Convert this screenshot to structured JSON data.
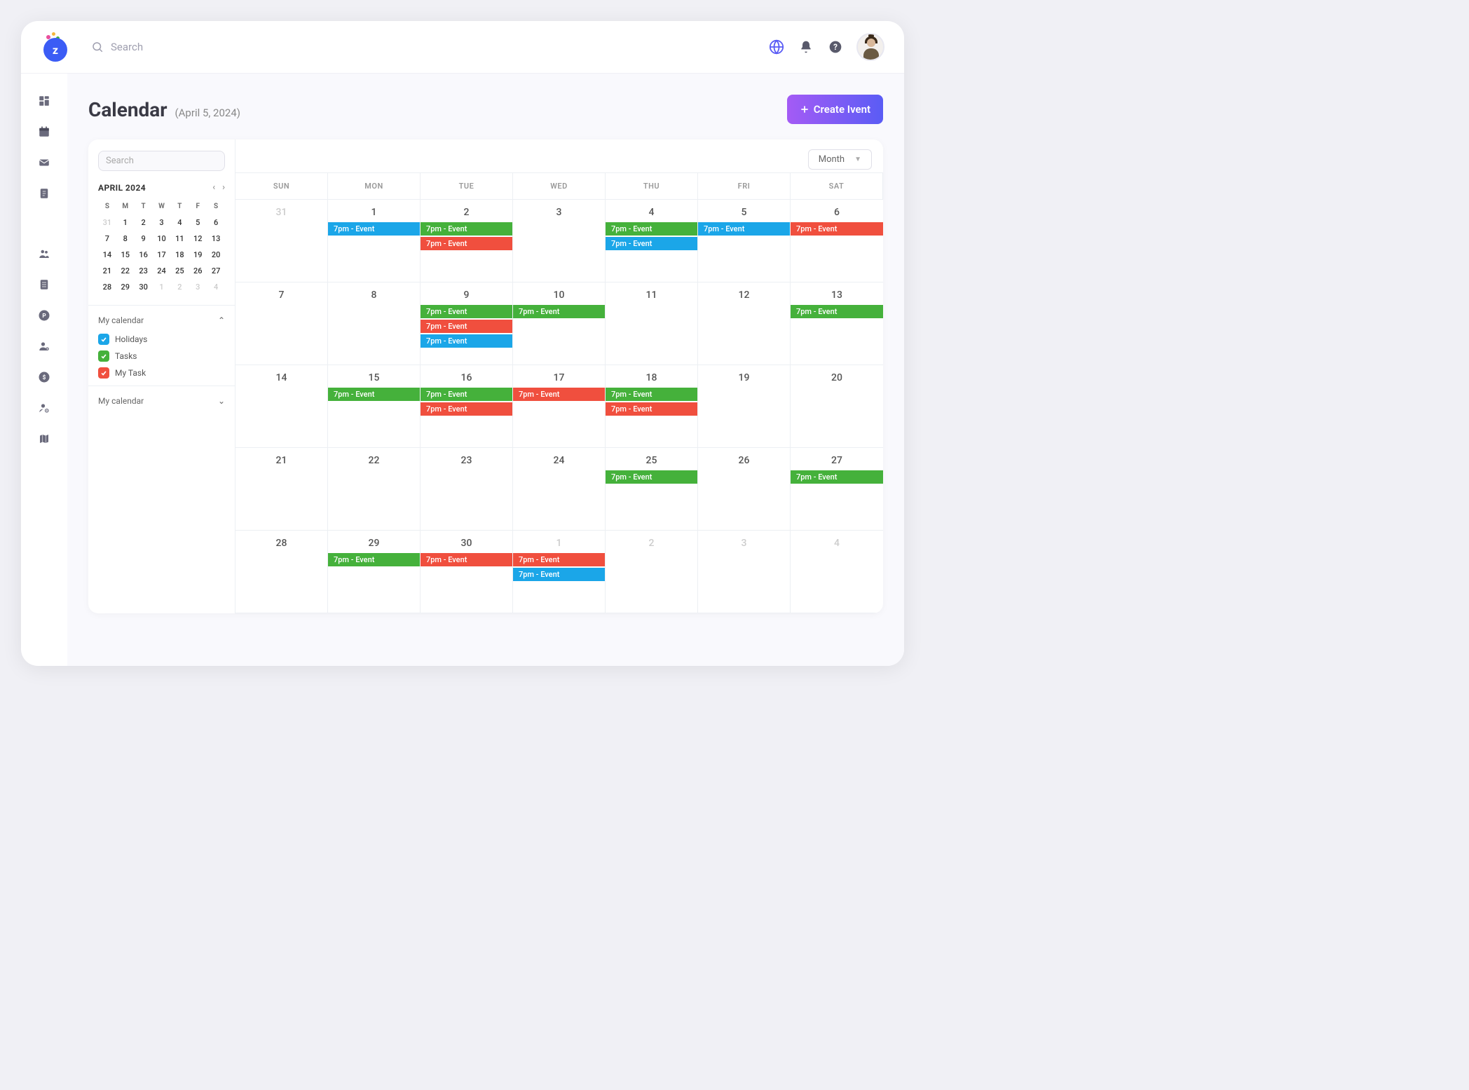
{
  "topbar": {
    "search_placeholder": "Search"
  },
  "page": {
    "title": "Calendar",
    "date_suffix": "(April 5, 2024)",
    "create_btn": "Create Ivent"
  },
  "panel": {
    "search_placeholder": "Search",
    "view_selected": "Month"
  },
  "mini_cal": {
    "month_label": "APRIL 2024",
    "dows": [
      "S",
      "M",
      "T",
      "W",
      "T",
      "F",
      "S"
    ],
    "days": [
      {
        "n": "31",
        "dim": true
      },
      {
        "n": "1"
      },
      {
        "n": "2"
      },
      {
        "n": "3"
      },
      {
        "n": "4"
      },
      {
        "n": "5"
      },
      {
        "n": "6"
      },
      {
        "n": "7"
      },
      {
        "n": "8"
      },
      {
        "n": "9"
      },
      {
        "n": "10"
      },
      {
        "n": "11"
      },
      {
        "n": "12"
      },
      {
        "n": "13"
      },
      {
        "n": "14"
      },
      {
        "n": "15"
      },
      {
        "n": "16"
      },
      {
        "n": "17"
      },
      {
        "n": "18"
      },
      {
        "n": "19"
      },
      {
        "n": "20"
      },
      {
        "n": "21"
      },
      {
        "n": "22"
      },
      {
        "n": "23"
      },
      {
        "n": "24"
      },
      {
        "n": "25"
      },
      {
        "n": "26"
      },
      {
        "n": "27"
      },
      {
        "n": "28"
      },
      {
        "n": "29"
      },
      {
        "n": "30"
      },
      {
        "n": "1",
        "dim": true
      },
      {
        "n": "2",
        "dim": true
      },
      {
        "n": "3",
        "dim": true
      },
      {
        "n": "4",
        "dim": true
      }
    ]
  },
  "cal_list": {
    "section1": "My calendar",
    "items": [
      {
        "label": "Holidays",
        "color": "blue"
      },
      {
        "label": "Tasks",
        "color": "green"
      },
      {
        "label": "My Task",
        "color": "red"
      }
    ],
    "section2": "My calendar"
  },
  "big_cal": {
    "dows": [
      "SUN",
      "MON",
      "TUE",
      "WED",
      "THU",
      "FRI",
      "SAT"
    ],
    "event_label": "7pm - Event",
    "weeks": [
      [
        {
          "n": "31",
          "dim": true,
          "events": []
        },
        {
          "n": "1",
          "events": [
            "blue"
          ]
        },
        {
          "n": "2",
          "events": [
            "green",
            "red"
          ]
        },
        {
          "n": "3",
          "events": []
        },
        {
          "n": "4",
          "events": [
            "green",
            "blue"
          ]
        },
        {
          "n": "5",
          "events": [
            "blue"
          ]
        },
        {
          "n": "6",
          "events": [
            "red"
          ]
        }
      ],
      [
        {
          "n": "7",
          "events": []
        },
        {
          "n": "8",
          "events": []
        },
        {
          "n": "9",
          "events": [
            "green",
            "red",
            "blue"
          ]
        },
        {
          "n": "10",
          "events": [
            "green"
          ]
        },
        {
          "n": "11",
          "events": []
        },
        {
          "n": "12",
          "events": []
        },
        {
          "n": "13",
          "events": [
            "green"
          ]
        }
      ],
      [
        {
          "n": "14",
          "events": []
        },
        {
          "n": "15",
          "events": [
            "green"
          ]
        },
        {
          "n": "16",
          "events": [
            "green",
            "red"
          ]
        },
        {
          "n": "17",
          "events": [
            "red"
          ]
        },
        {
          "n": "18",
          "events": [
            "green",
            "red"
          ]
        },
        {
          "n": "19",
          "events": []
        },
        {
          "n": "20",
          "events": []
        }
      ],
      [
        {
          "n": "21",
          "events": []
        },
        {
          "n": "22",
          "events": []
        },
        {
          "n": "23",
          "events": []
        },
        {
          "n": "24",
          "events": []
        },
        {
          "n": "25",
          "events": [
            "green"
          ]
        },
        {
          "n": "26",
          "events": []
        },
        {
          "n": "27",
          "events": [
            "green"
          ]
        }
      ],
      [
        {
          "n": "28",
          "events": []
        },
        {
          "n": "29",
          "events": [
            "green"
          ]
        },
        {
          "n": "30",
          "events": [
            "red"
          ]
        },
        {
          "n": "1",
          "dim": true,
          "events": [
            "red",
            "blue"
          ]
        },
        {
          "n": "2",
          "dim": true,
          "events": []
        },
        {
          "n": "3",
          "dim": true,
          "events": []
        },
        {
          "n": "4",
          "dim": true,
          "events": []
        }
      ]
    ]
  },
  "colors": {
    "blue": "#1ba6e8",
    "green": "#45b13b",
    "red": "#f04f3e",
    "accent": "#5a5cf5"
  }
}
